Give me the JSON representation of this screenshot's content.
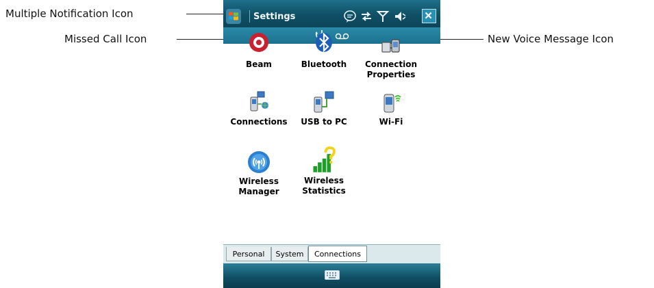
{
  "callouts": {
    "multiple_notification": "Multiple Notification Icon",
    "missed_call": "Missed Call Icon",
    "new_voice_message": "New Voice Message Icon"
  },
  "window": {
    "title": "Settings"
  },
  "apps": [
    {
      "label": "Beam",
      "icon": "beam-icon"
    },
    {
      "label": "Bluetooth",
      "icon": "bluetooth-icon"
    },
    {
      "label": "Connection\nProperties",
      "icon": "connection-properties-icon"
    },
    {
      "label": "Connections",
      "icon": "connections-icon"
    },
    {
      "label": "USB to PC",
      "icon": "usb-to-pc-icon"
    },
    {
      "label": "Wi-Fi",
      "icon": "wifi-icon"
    },
    {
      "label": "Wireless\nManager",
      "icon": "wireless-manager-icon"
    },
    {
      "label": "Wireless\nStatistics",
      "icon": "wireless-statistics-icon"
    }
  ],
  "tabs": [
    {
      "label": "Personal",
      "active": false
    },
    {
      "label": "System",
      "active": false
    },
    {
      "label": "Connections",
      "active": true
    }
  ],
  "colors": {
    "taskbar": "#0f4f66",
    "notif_bar": "#2a8aa8",
    "tab_bg": "#dbe9ec"
  }
}
